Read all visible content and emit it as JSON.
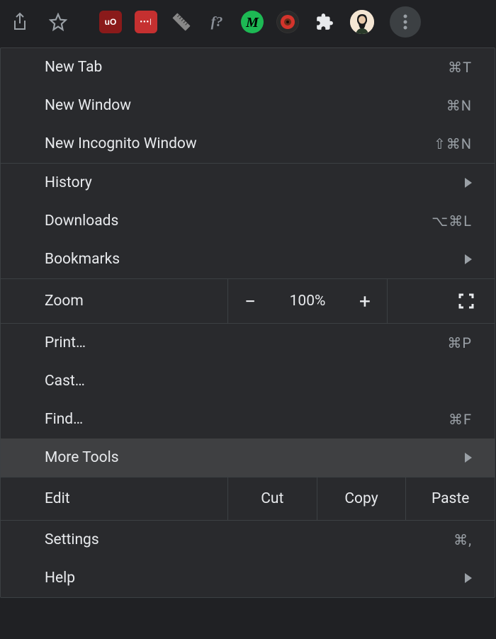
{
  "toolbar": {
    "extensions": [
      "ublock",
      "1password",
      "ruler",
      "font-detect",
      "m-ext",
      "eye-ext"
    ]
  },
  "menu": {
    "new_tab": {
      "label": "New Tab",
      "shortcut": "⌘T"
    },
    "new_window": {
      "label": "New Window",
      "shortcut": "⌘N"
    },
    "new_incognito": {
      "label": "New Incognito Window",
      "shortcut": "⇧⌘N"
    },
    "history": {
      "label": "History"
    },
    "downloads": {
      "label": "Downloads",
      "shortcut": "⌥⌘L"
    },
    "bookmarks": {
      "label": "Bookmarks"
    },
    "zoom": {
      "label": "Zoom",
      "value": "100%"
    },
    "print": {
      "label": "Print…",
      "shortcut": "⌘P"
    },
    "cast": {
      "label": "Cast…"
    },
    "find": {
      "label": "Find…",
      "shortcut": "⌘F"
    },
    "more_tools": {
      "label": "More Tools"
    },
    "edit": {
      "label": "Edit",
      "cut": "Cut",
      "copy": "Copy",
      "paste": "Paste"
    },
    "settings": {
      "label": "Settings",
      "shortcut": "⌘,"
    },
    "help": {
      "label": "Help"
    }
  }
}
